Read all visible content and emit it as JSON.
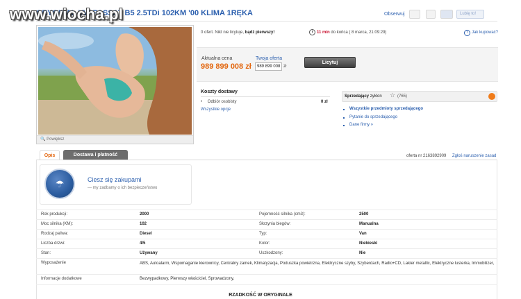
{
  "header": {
    "title": "ORYGINAŁ VW PASSAT B5 2.5TDi 102KM '00 KLIMA 1RĘKA",
    "watermark": "www.wiocha.pl",
    "observe": "Obserwuj",
    "like": "Lubię to!"
  },
  "photo": {
    "zoom": "Powiększ"
  },
  "auction": {
    "no_bids_prefix": "0 ofert. Nikt nie licytuje,",
    "no_bids_bold": "bądź pierwszy!",
    "time_left": "11 min",
    "time_suffix": "do końca",
    "end_date": "( 8 marca, 21:09:29)",
    "how_to_buy": "Jak kupować?"
  },
  "price": {
    "current_label": "Aktualna cena",
    "current_value": "989 899 008 zł",
    "your_offer_label": "Twoja oferta",
    "offer_input_value": "989 899 008",
    "currency": "zł",
    "bid_button": "Licytuj"
  },
  "shipping": {
    "title": "Koszty dostawy",
    "item": "Odbiór osobisty",
    "item_price": "0 zł",
    "all_options": "Wszystkie opcje"
  },
  "seller": {
    "title_bold": "Sprzedający",
    "title_rest": "zyklon",
    "count": "(765)",
    "links": [
      "Wszystkie przedmioty sprzedającego",
      "Pytanie do sprzedającego",
      "Dane firmy »"
    ]
  },
  "tabs": {
    "description": "Opis",
    "delivery": "Dostawa i płatność"
  },
  "offer_info": {
    "offer_number": "oferta nr 2163892909",
    "report": "Zgłoś naruszenie zasad"
  },
  "badge": {
    "title": "Ciesz się zakupami",
    "subtitle": "— my zadbamy o ich bezpieczeństwo"
  },
  "params": {
    "left": [
      {
        "label": "Rok produkcji:",
        "value": "2000"
      },
      {
        "label": "Moc silnika (KM):",
        "value": "102"
      },
      {
        "label": "Rodzaj paliwa:",
        "value": "Diesel"
      },
      {
        "label": "Liczba drzwi:",
        "value": "4/5"
      },
      {
        "label": "Stan:",
        "value": "Używany"
      }
    ],
    "right": [
      {
        "label": "Pojemność silnika (cm3):",
        "value": "2500"
      },
      {
        "label": "Skrzynia biegów:",
        "value": "Manualna"
      },
      {
        "label": "Typ:",
        "value": "Van"
      },
      {
        "label": "Kolor:",
        "value": "Niebieski"
      },
      {
        "label": "Uszkodzony:",
        "value": "Nie"
      }
    ],
    "equipment_label": "Wyposażenie",
    "equipment_value": "ABS, Autoalarm, Wspomaganie kierownicy, Centralny zamek, Klimatyzacja, Poduszka powietrzna, Elektryczne szyby, Szyberdach, Radio+CD, Lakier metallic, Elektryczne lusterka, Immobilizer,",
    "extra_label": "Informacje dodatkowe",
    "extra_value": "Bezwypadkowy, Pierwszy właściciel, Sprowadzony,"
  },
  "bottom_title": "RZADKOŚĆ W ORYGINALE"
}
